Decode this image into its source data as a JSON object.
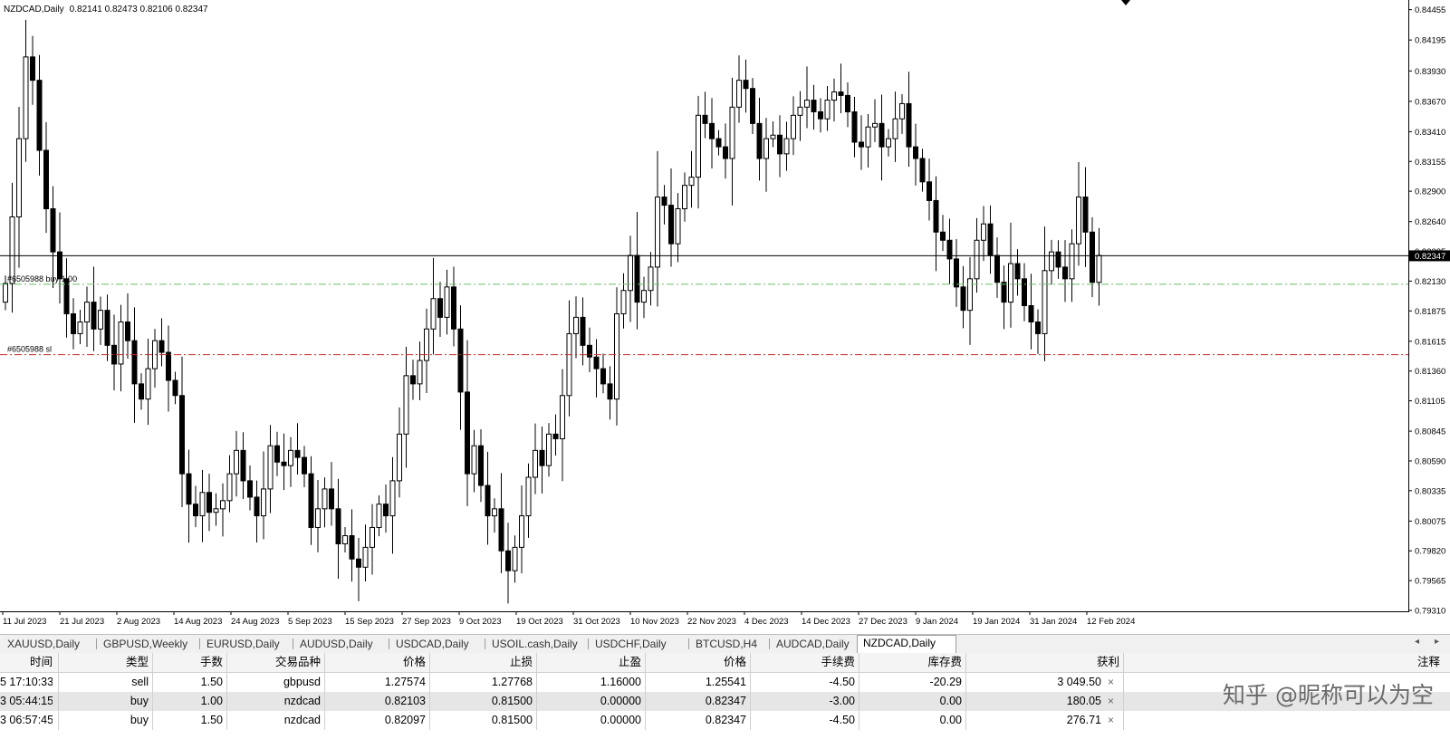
{
  "chart_data": {
    "type": "candlestick",
    "symbol_label": "NZDCAD,Daily",
    "ohlc_text": "0.82141 0.82473 0.82106 0.82347",
    "ylim": [
      0.7931,
      0.8446
    ],
    "y_ticks": [
      "0.84455",
      "0.84195",
      "0.83930",
      "0.83670",
      "0.83410",
      "0.83155",
      "0.82900",
      "0.82640",
      "0.82385",
      "0.82130",
      "0.81875",
      "0.81615",
      "0.81360",
      "0.81105",
      "0.80845",
      "0.80590",
      "0.80335",
      "0.80075",
      "0.79820",
      "0.79565",
      "0.79310"
    ],
    "x_ticks": [
      "11 Jul 2023",
      "21 Jul 2023",
      "2 Aug 2023",
      "14 Aug 2023",
      "24 Aug 2023",
      "5 Sep 2023",
      "15 Sep 2023",
      "27 Sep 2023",
      "9 Oct 2023",
      "19 Oct 2023",
      "31 Oct 2023",
      "10 Nov 2023",
      "22 Nov 2023",
      "4 Dec 2023",
      "14 Dec 2023",
      "27 Dec 2023",
      "9 Jan 2024",
      "19 Jan 2024",
      "31 Jan 2024",
      "12 Feb 2024"
    ],
    "current_price": "0.82347",
    "levels": [
      {
        "label": "#6505988 buy 1.00",
        "price": 0.82103,
        "color": "#6abf69"
      },
      {
        "label": "#6505988 sl",
        "price": 0.815,
        "color": "#c62828"
      }
    ],
    "closes": [
      0.8211,
      0.8268,
      0.8335,
      0.8405,
      0.8385,
      0.8325,
      0.8275,
      0.8238,
      0.8215,
      0.8185,
      0.8168,
      0.8178,
      0.8195,
      0.8172,
      0.8188,
      0.8158,
      0.8142,
      0.8178,
      0.8162,
      0.8125,
      0.8112,
      0.8138,
      0.8162,
      0.8152,
      0.8128,
      0.8115,
      0.8048,
      0.8022,
      0.8012,
      0.8032,
      0.8015,
      0.8018,
      0.8025,
      0.8048,
      0.8068,
      0.8042,
      0.8028,
      0.8012,
      0.8035,
      0.8072,
      0.8058,
      0.8055,
      0.8068,
      0.8062,
      0.8048,
      0.8002,
      0.8018,
      0.8035,
      0.8018,
      0.7988,
      0.7995,
      0.7975,
      0.7968,
      0.7985,
      0.8002,
      0.8022,
      0.8012,
      0.8042,
      0.8082,
      0.8132,
      0.8125,
      0.8145,
      0.8172,
      0.8198,
      0.8182,
      0.8208,
      0.8172,
      0.8118,
      0.8048,
      0.8072,
      0.8038,
      0.8012,
      0.8018,
      0.7982,
      0.7965,
      0.7985,
      0.8012,
      0.8045,
      0.8068,
      0.8055,
      0.8082,
      0.8078,
      0.8115,
      0.8168,
      0.8182,
      0.8158,
      0.8148,
      0.8138,
      0.8125,
      0.8112,
      0.8185,
      0.8205,
      0.8235,
      0.8195,
      0.8205,
      0.8225,
      0.8285,
      0.8278,
      0.8245,
      0.8275,
      0.8295,
      0.8302,
      0.8355,
      0.8348,
      0.8335,
      0.8328,
      0.8318,
      0.8362,
      0.8385,
      0.8378,
      0.8348,
      0.8318,
      0.8335,
      0.8338,
      0.8322,
      0.8335,
      0.8355,
      0.8362,
      0.8368,
      0.8358,
      0.8352,
      0.8368,
      0.8375,
      0.8372,
      0.8358,
      0.8332,
      0.8328,
      0.8345,
      0.8348,
      0.8328,
      0.8335,
      0.8352,
      0.8365,
      0.8328,
      0.8318,
      0.8298,
      0.8282,
      0.8255,
      0.8248,
      0.8232,
      0.8208,
      0.8188,
      0.8215,
      0.8248,
      0.8262,
      0.8235,
      0.8212,
      0.8195,
      0.8228,
      0.8215,
      0.8192,
      0.8178,
      0.8168,
      0.8222,
      0.8238,
      0.8225,
      0.8215,
      0.8245,
      0.8285,
      0.8255,
      0.8212,
      0.8235
    ]
  },
  "tabs": {
    "items": [
      "XAUUSD,Daily",
      "GBPUSD,Weekly",
      "EURUSD,Daily",
      "AUDUSD,Daily",
      "USDCAD,Daily",
      "USOIL.cash,Daily",
      "USDCHF,Daily",
      "BTCUSD,H4",
      "AUDCAD,Daily",
      "NZDCAD,Daily"
    ],
    "active_index": 9,
    "scroll_left": "◂",
    "scroll_right": "▸"
  },
  "trade_table": {
    "headers": {
      "time": "时间",
      "type": "类型",
      "lots": "手数",
      "symbol": "交易品种",
      "open_price": "价格",
      "sl": "止损",
      "tp": "止盈",
      "price": "价格",
      "commission": "手续费",
      "swap": "库存费",
      "profit": "获利",
      "comment": "注释"
    },
    "rows": [
      {
        "time": "5 17:10:33",
        "type": "sell",
        "lots": "1.50",
        "symbol": "gbpusd",
        "open_price": "1.27574",
        "sl": "1.27768",
        "tp": "1.16000",
        "price": "1.25541",
        "commission": "-4.50",
        "swap": "-20.29",
        "profit": "3 049.50"
      },
      {
        "time": "3 05:44:15",
        "type": "buy",
        "lots": "1.00",
        "symbol": "nzdcad",
        "open_price": "0.82103",
        "sl": "0.81500",
        "tp": "0.00000",
        "price": "0.82347",
        "commission": "-3.00",
        "swap": "0.00",
        "profit": "180.05"
      },
      {
        "time": "3 06:57:45",
        "type": "buy",
        "lots": "1.50",
        "symbol": "nzdcad",
        "open_price": "0.82097",
        "sl": "0.81500",
        "tp": "0.00000",
        "price": "0.82347",
        "commission": "-4.50",
        "swap": "0.00",
        "profit": "276.71"
      }
    ],
    "close_glyph": "×"
  },
  "watermark": "知乎 @昵称可以为空"
}
